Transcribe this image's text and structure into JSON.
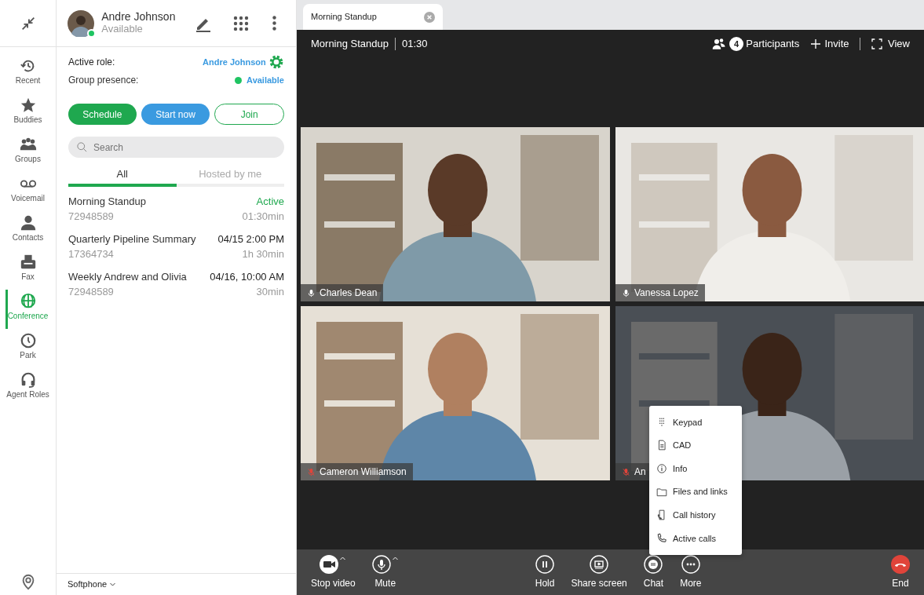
{
  "rail": {
    "items": [
      {
        "label": "Recent",
        "selected": false
      },
      {
        "label": "Buddies",
        "selected": false
      },
      {
        "label": "Groups",
        "selected": false
      },
      {
        "label": "Voicemail",
        "selected": false
      },
      {
        "label": "Contacts",
        "selected": false
      },
      {
        "label": "Fax",
        "selected": false
      },
      {
        "label": "Conference",
        "selected": true
      },
      {
        "label": "Park",
        "selected": false
      },
      {
        "label": "Agent Roles",
        "selected": false
      }
    ]
  },
  "user": {
    "name": "Andre Johnson",
    "presence": "Available",
    "online": true
  },
  "roles": {
    "active_role_label": "Active role:",
    "active_role": "Andre Johnson",
    "group_presence_label": "Group presence:",
    "group_presence": "Available"
  },
  "actions": [
    "Schedule",
    "Start now",
    "Join"
  ],
  "search": {
    "placeholder": "Search"
  },
  "filter_tabs": [
    {
      "label": "All",
      "selected": true
    },
    {
      "label": "Hosted by me",
      "selected": false
    }
  ],
  "meetings": [
    {
      "title": "Morning Standup",
      "id": "72948589",
      "when": "Active",
      "duration": "01:30min",
      "active": true
    },
    {
      "title": "Quarterly Pipeline Summary",
      "id": "17364734",
      "when": "04/15 2:00 PM",
      "duration": "1h 30min",
      "active": false
    },
    {
      "title": "Weekly Andrew and Olivia",
      "id": "72948589",
      "when": "04/16, 10:00 AM",
      "duration": "30min",
      "active": false
    }
  ],
  "footer": {
    "mode": "Softphone"
  },
  "window_tabs": [
    {
      "label": "Morning Standup",
      "selected": true
    }
  ],
  "call": {
    "title": "Morning Standup",
    "elapsed": "01:30",
    "participant_count": "4",
    "participants_label": "Participants",
    "invite": "Invite",
    "view": "View"
  },
  "tiles": [
    {
      "name": "Charles Dean",
      "muted": false,
      "kind": "picture"
    },
    {
      "name": "Vanessa Lopez",
      "muted": false,
      "kind": "picture"
    },
    {
      "name": "Cameron Williamson",
      "muted": true,
      "kind": "picture"
    },
    {
      "name": "An",
      "muted": true,
      "kind": "picture"
    }
  ],
  "more_menu": [
    {
      "label": "Keypad"
    },
    {
      "label": "CAD"
    },
    {
      "label": "Info"
    },
    {
      "label": "Files and links"
    },
    {
      "label": "Call history"
    },
    {
      "label": "Active calls"
    }
  ],
  "controls": [
    {
      "label": "Stop video",
      "caret": true
    },
    {
      "label": "Mute",
      "caret": true
    },
    {
      "label": "Hold",
      "caret": false
    },
    {
      "label": "Share screen",
      "caret": false
    },
    {
      "label": "Chat",
      "caret": false
    },
    {
      "label": "More",
      "caret": false
    },
    {
      "label": "End",
      "caret": false
    }
  ]
}
